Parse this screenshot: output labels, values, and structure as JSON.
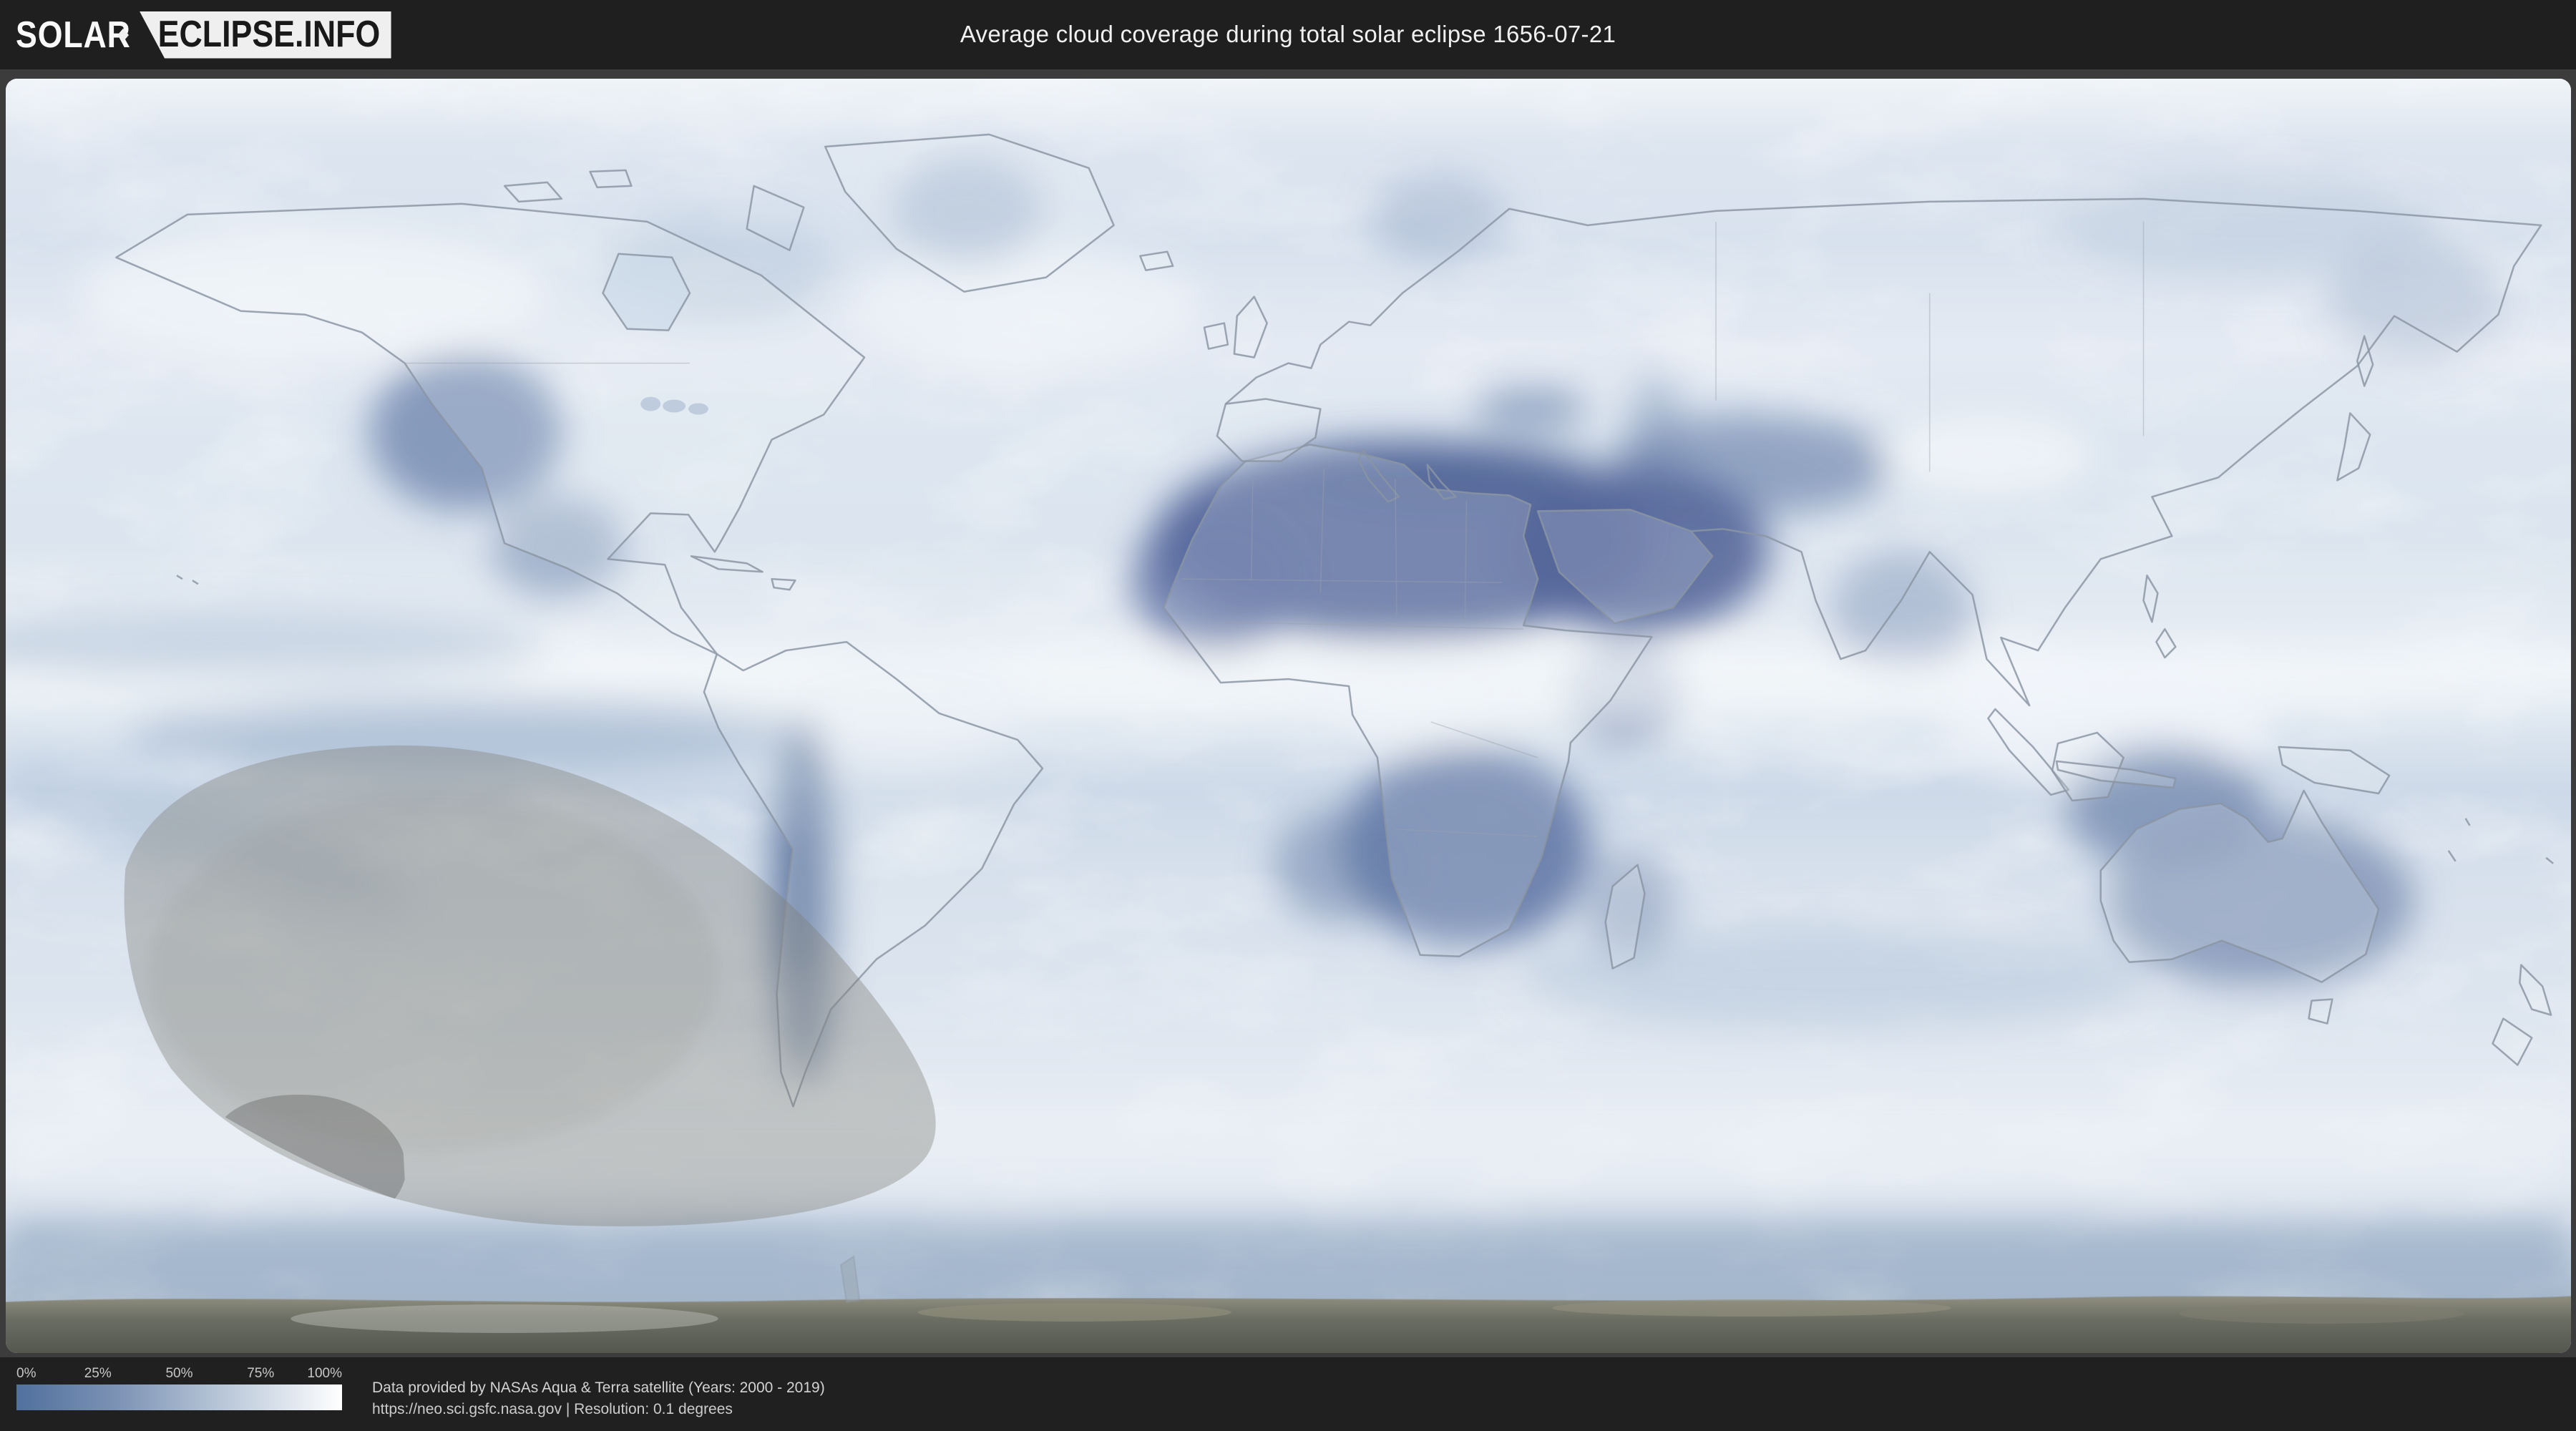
{
  "header": {
    "logo_primary": "SOLAR",
    "logo_secondary": "ECLIPSE.INFO",
    "title": "Average cloud coverage during total solar eclipse 1656-07-21",
    "background_color": "#1f1f1f"
  },
  "map": {
    "description": "World map of average cloud coverage (blue = clear, white = cloudy) with gray solar eclipse shadow path overlay in the South Pacific and southern South America",
    "colors": {
      "clear_sky_dark_blue": "#54679a",
      "cloudy_white": "#f4f7fa",
      "ocean_base": "#dfe7f1",
      "antarctica_gray": "#5c5f55",
      "coastline": "#8b95a3",
      "eclipse_penumbra": "rgba(125,125,118,0.38)",
      "eclipse_umbra": "rgba(95,95,95,0.40)"
    },
    "features": [
      "sahara-clear-zone",
      "arabia-clear-zone",
      "southern-africa-clear-zone",
      "australia-clear-zone",
      "western-us-clear-zone",
      "andes-clear-strip",
      "itcz-cloud-band",
      "southern-ocean-cloud-band",
      "antarctica-band",
      "eclipse-shadow-path-south-pacific"
    ]
  },
  "legend": {
    "ticks": [
      "0%",
      "25%",
      "50%",
      "75%",
      "100%"
    ],
    "gradient_start_color": "#50709e",
    "gradient_end_color": "#ffffff"
  },
  "footer": {
    "attribution_line1": "Data provided by NASAs Aqua & Terra satellite (Years: 2000 - 2019)",
    "attribution_line2": "https://neo.sci.gsfc.nasa.gov | Resolution: 0.1 degrees",
    "background_color": "#202020"
  }
}
